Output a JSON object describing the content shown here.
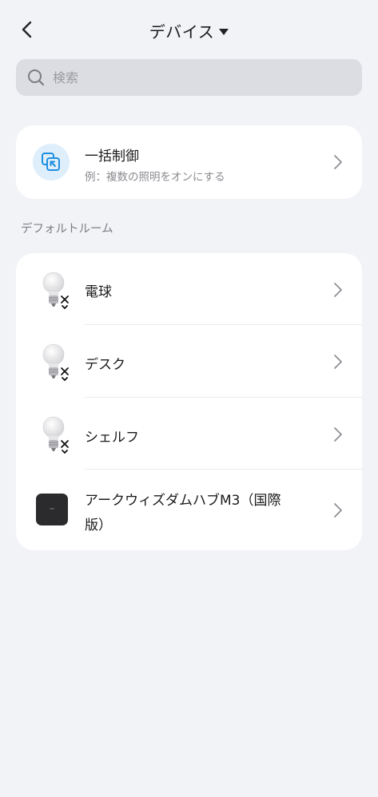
{
  "header": {
    "title": "デバイス"
  },
  "search": {
    "placeholder": "検索"
  },
  "bulk_control": {
    "title": "一括制御",
    "subtitle": "例：複数の照明をオンにする"
  },
  "room": {
    "label": "デフォルトルーム",
    "devices": [
      {
        "name": "電球",
        "icon": "bulb-icon"
      },
      {
        "name": "デスク",
        "icon": "bulb-icon"
      },
      {
        "name": "シェルフ",
        "icon": "bulb-icon"
      },
      {
        "name_line1": "アークウィズダムハブM3（国際",
        "name_line2": "版）",
        "icon": "hub-icon"
      }
    ]
  },
  "colors": {
    "background": "#f2f3f7",
    "card": "#ffffff",
    "search_bg": "#dcdde2",
    "accent": "#1e8fe0"
  }
}
